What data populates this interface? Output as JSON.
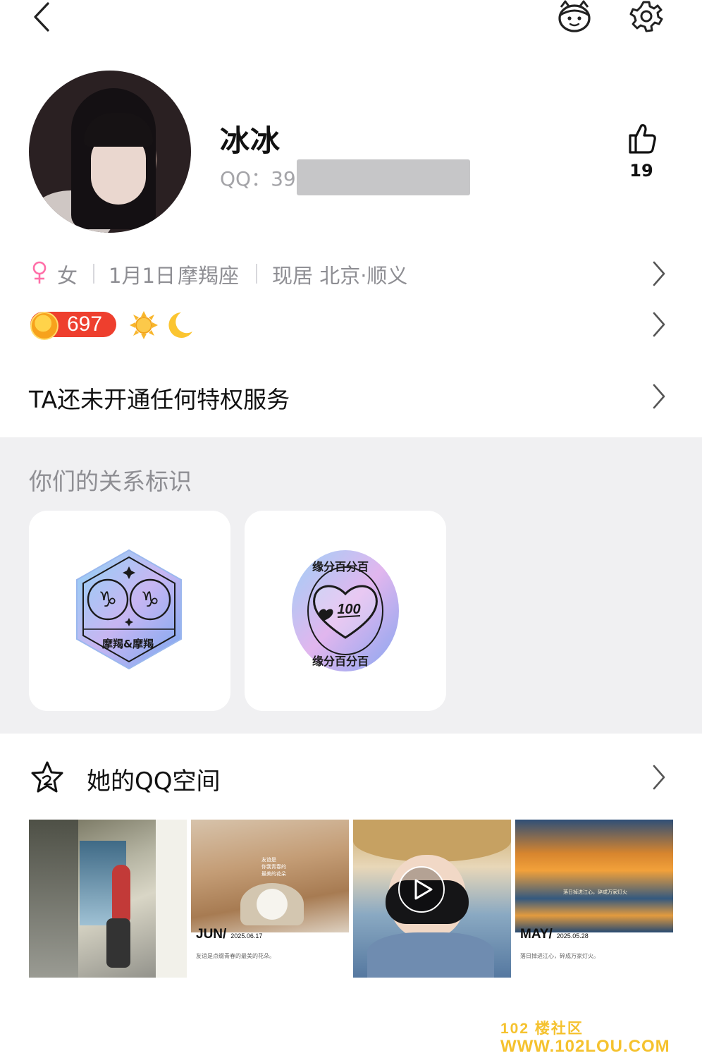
{
  "profile": {
    "name": "冰冰",
    "qq_label": "QQ：39",
    "like_count": "19"
  },
  "info": {
    "gender": "女",
    "birthday": "1月1日",
    "zodiac": "摩羯座",
    "location": "现居  北京·顺义"
  },
  "level": {
    "value": "697"
  },
  "privilege": {
    "text": "TA还未开通任何特权服务"
  },
  "relations": {
    "title": "你们的关系标识",
    "cards": [
      {
        "label": "摩羯&摩羯"
      },
      {
        "label_top": "缘分百分百",
        "label_bottom": "缘分百分百",
        "value": "100"
      }
    ]
  },
  "qzone": {
    "title": "她的QQ空间",
    "thumbs": [
      {},
      {
        "month": "JUN/",
        "date": "2025.06.17",
        "caption": "友谊是点缀青春的最美的花朵。",
        "overlay": "友谊是\n你我青春的\n最美的花朵"
      },
      {},
      {
        "month": "MAY/",
        "date": "2025.05.28",
        "caption": "落日掉进江心，碎成万家灯火。",
        "overlay": "落日掉进江心，碎成万家灯火"
      }
    ]
  },
  "watermark": {
    "line1": "102 楼社区",
    "line2": "WWW.102LOU.COM"
  }
}
